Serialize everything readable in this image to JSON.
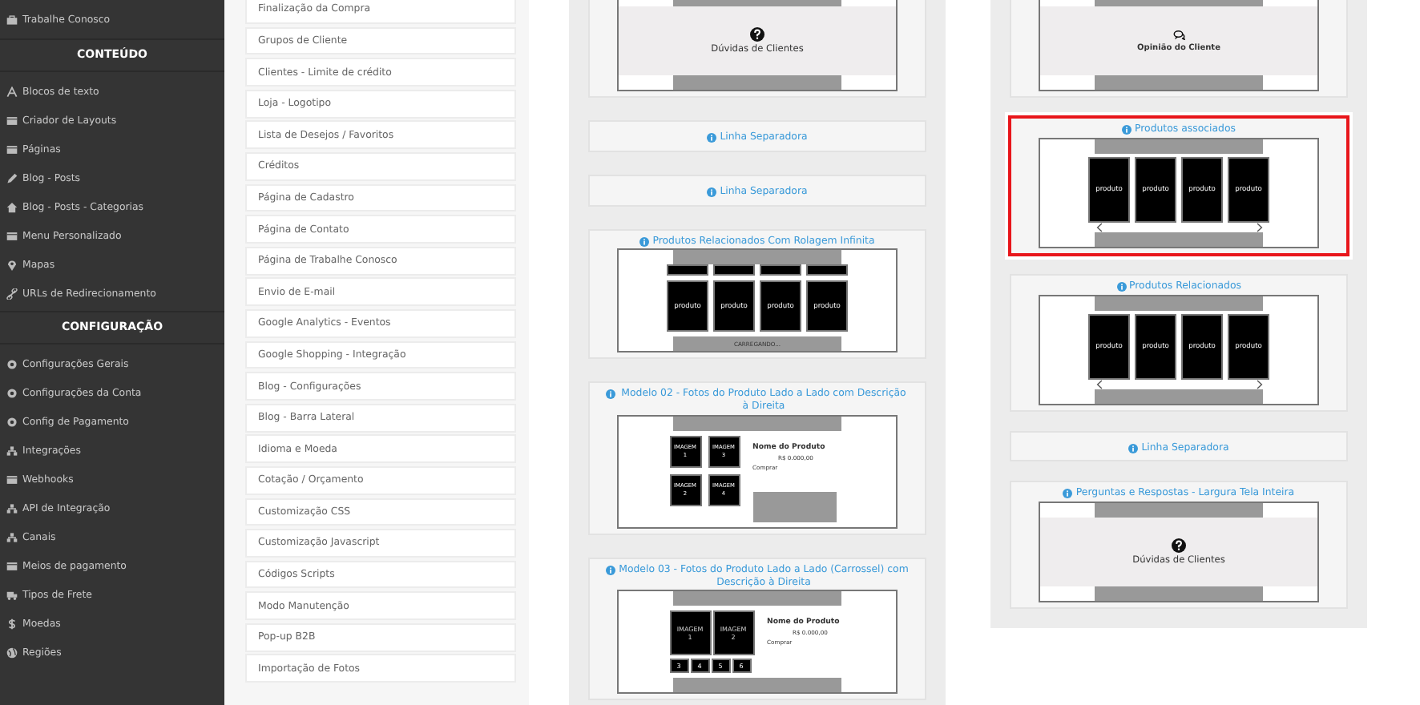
{
  "sidebar": {
    "top_item": {
      "label": "Trabalhe Conosco"
    },
    "sections": [
      {
        "heading": "CONTEÚDO",
        "items": [
          {
            "label": "Blocos de texto"
          },
          {
            "label": "Criador de Layouts"
          },
          {
            "label": "Páginas"
          },
          {
            "label": "Blog - Posts"
          },
          {
            "label": "Blog - Posts - Categorias"
          },
          {
            "label": "Menu Personalizado"
          },
          {
            "label": "Mapas"
          },
          {
            "label": "URLs de Redirecionamento"
          }
        ]
      },
      {
        "heading": "CONFIGURAÇÃO",
        "items": [
          {
            "label": "Configurações Gerais"
          },
          {
            "label": "Configurações da Conta"
          },
          {
            "label": "Config de Pagamento"
          },
          {
            "label": "Integrações"
          },
          {
            "label": "Webhooks"
          },
          {
            "label": "API de Integração"
          },
          {
            "label": "Canais"
          },
          {
            "label": "Meios de pagamento"
          },
          {
            "label": "Tipos de Frete"
          },
          {
            "label": "Moedas"
          },
          {
            "label": "Regiões"
          }
        ]
      }
    ]
  },
  "settings_list": [
    "Finalização da Compra",
    "Grupos de Cliente",
    "Clientes - Limite de crédito",
    "Loja - Logotipo",
    "Lista de Desejos / Favoritos",
    "Créditos",
    "Página de Cadastro",
    "Página de Contato",
    "Página de Trabalhe Conosco",
    "Envio de E-mail",
    "Google Analytics - Eventos",
    "Google Shopping - Integração",
    "Blog - Configurações",
    "Blog - Barra Lateral",
    "Idioma e Moeda",
    "Cotação / Orçamento",
    "Customização CSS",
    "Customização Javascript",
    "Códigos Scripts",
    "Modo Manutenção",
    "Pop-up B2B",
    "Importação de Fotos"
  ],
  "columns": [
    {
      "cards": [
        {
          "kind": "faq",
          "selected": false,
          "caption": "Dúvidas de Clientes"
        },
        {
          "kind": "separator",
          "selected": false,
          "title": "Linha Separadora"
        },
        {
          "kind": "separator",
          "selected": false,
          "title": "Linha Separadora"
        },
        {
          "kind": "infinite",
          "selected": false,
          "title": "Produtos Relacionados Com Rolagem Infinita",
          "products": [
            "produto",
            "produto",
            "produto",
            "produto"
          ],
          "loading": "CARREGANDO..."
        },
        {
          "kind": "model02",
          "selected": false,
          "title": "Modelo 02 - Fotos do Produto Lado a Lado com Descrição à Direita",
          "images": [
            "IMAGEM 1",
            "IMAGEM 3",
            "IMAGEM 2",
            "IMAGEM 4"
          ],
          "name": "Nome do Produto",
          "price": "R$ 0.000,00",
          "buy": "Comprar"
        },
        {
          "kind": "model03",
          "selected": false,
          "title": "Modelo 03 - Fotos do Produto Lado a Lado (Carrossel) com Descrição à Direita",
          "images": [
            "IMAGEM 1",
            "IMAGEM 2"
          ],
          "thumbs": [
            "3",
            "4",
            "5",
            "6"
          ],
          "name": "Nome do Produto",
          "price": "R$ 0.000,00",
          "buy": "Comprar"
        }
      ]
    },
    {
      "cards": [
        {
          "kind": "opinion",
          "selected": false,
          "caption": "Opinião do Cliente"
        },
        {
          "kind": "products",
          "selected": true,
          "title": "Produtos associados",
          "products": [
            "produto",
            "produto",
            "produto",
            "produto"
          ]
        },
        {
          "kind": "products",
          "selected": false,
          "title": "Produtos Relacionados",
          "products": [
            "produto",
            "produto",
            "produto",
            "produto"
          ]
        },
        {
          "kind": "separator",
          "selected": false,
          "title": "Linha Separadora"
        },
        {
          "kind": "faq",
          "selected": false,
          "title": "Perguntas e Respostas - Largura Tela Inteira",
          "caption": "Dúvidas de Clientes"
        }
      ]
    }
  ]
}
